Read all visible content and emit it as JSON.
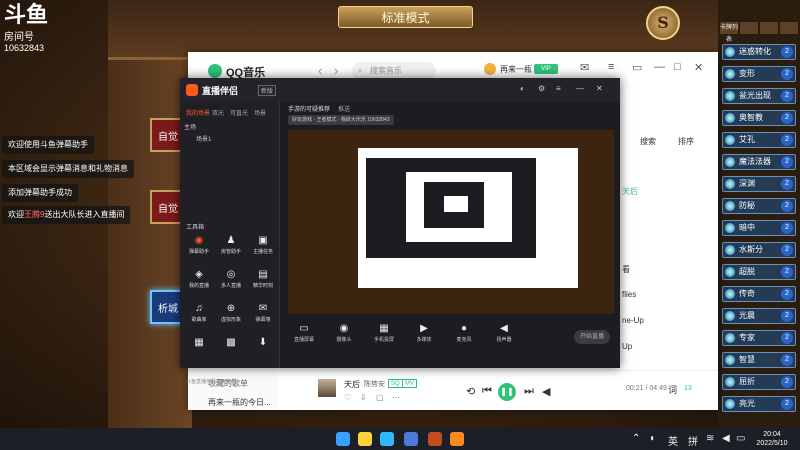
{
  "stream": {
    "logo": "斗鱼",
    "room_label": "房间号",
    "room_number": "10632843",
    "chat": [
      {
        "text": "欢迎使用斗鱼弹幕助手"
      },
      {
        "text": "本区域会显示弹幕消息和礼物消息"
      },
      {
        "text": "添加弹幕助手成功"
      },
      {
        "text_prefix": "欢迎",
        "highlight": "王腾9",
        "text_suffix": "送出大队长进入直播间"
      }
    ]
  },
  "game": {
    "title_plate": "标准模式",
    "emblem": "S",
    "deck_labels": [
      "自觉",
      "自觉",
      "析城"
    ]
  },
  "rank": {
    "tabs": [
      "卡牌列表",
      "",
      "",
      ""
    ],
    "rows": [
      {
        "name": "迷惑转化",
        "cost": "2"
      },
      {
        "name": "变形",
        "cost": "2"
      },
      {
        "name": "瓮光出现",
        "cost": "2"
      },
      {
        "name": "奥智教",
        "cost": "2"
      },
      {
        "name": "艾孔",
        "cost": "2"
      },
      {
        "name": "魔法法器",
        "cost": "2"
      },
      {
        "name": "深渊",
        "cost": "2"
      },
      {
        "name": "防秘",
        "cost": "2"
      },
      {
        "name": "暗中",
        "cost": "2"
      },
      {
        "name": "水斯分",
        "cost": "2"
      },
      {
        "name": "超脱",
        "cost": "2"
      },
      {
        "name": "传奇",
        "cost": "2"
      },
      {
        "name": "光晨",
        "cost": "2"
      },
      {
        "name": "专家",
        "cost": "2"
      },
      {
        "name": "智慧",
        "cost": "2"
      },
      {
        "name": "屈折",
        "cost": "2"
      },
      {
        "name": "亮光",
        "cost": "2"
      }
    ]
  },
  "qq_music": {
    "app_name": "QQ音乐",
    "search_placeholder": "搜索音乐",
    "user": "再来一瓶",
    "vip": "VIP",
    "right": {
      "search": "搜索",
      "sort": "排序",
      "song_highlight": "天后",
      "item1": "看",
      "item2": "flies",
      "item3": "ne-Up",
      "item4": "Up"
    },
    "sidebar": {
      "fav_head": "收藏的歌单",
      "fav_item": "再来一瓶的今日..."
    },
    "player": {
      "song": "天后",
      "artist": "陈势安",
      "tag1": "SQ",
      "tag2": "MV",
      "time": "00:21 / 04:49",
      "count": "13"
    },
    "accent": "#31c27c"
  },
  "companion": {
    "app_name": "直播伴侣",
    "version": "新版",
    "tabs": [
      "我的场景",
      "双光",
      "可直光",
      "场景"
    ],
    "scene_default": "场景1",
    "scene_row1": "主场",
    "tools_head": "工具箱",
    "tools": [
      {
        "icon": "◉",
        "label": "弹幕助手",
        "hot": true
      },
      {
        "icon": "♟",
        "label": "房管助手",
        "hot": false
      },
      {
        "icon": "▣",
        "label": "主播任务",
        "hot": false
      },
      {
        "icon": "◈",
        "label": "我的直播",
        "hot": false
      },
      {
        "icon": "◎",
        "label": "多人直播",
        "hot": false
      },
      {
        "icon": "▤",
        "label": "精华时刻",
        "hot": false
      },
      {
        "icon": "♫",
        "label": "歌曲库",
        "hot": false
      },
      {
        "icon": "⊕",
        "label": "虚拟形象",
        "hot": false
      },
      {
        "icon": "✉",
        "label": "弹幕墙",
        "hot": false
      },
      {
        "icon": "▦",
        "label": "",
        "hot": false
      },
      {
        "icon": "▩",
        "label": "",
        "hot": false
      },
      {
        "icon": "⬇",
        "label": "",
        "hot": false
      }
    ],
    "footer": "斗鱼直播伴侣使用教程",
    "stream_title": "手游的可疑推荐",
    "stream_tag": "推送",
    "room_info": "好玩游戏 · 王者模式 · 我欲大乐乐 10632843",
    "bottom": [
      {
        "icon": "▭",
        "label": "直播屏幕"
      },
      {
        "icon": "◉",
        "label": "摄像头"
      },
      {
        "icon": "▦",
        "label": "手机投屏"
      },
      {
        "icon": "▶",
        "label": "多媒体"
      },
      {
        "icon": "●",
        "label": "麦克风"
      },
      {
        "icon": "◀",
        "label": "扬声器"
      }
    ],
    "go_live": "开始直播",
    "accent": "#ff5a1e"
  },
  "taskbar": {
    "lang1": "英",
    "lang2": "拼",
    "time": "20:04",
    "date": "2022/5/10"
  }
}
